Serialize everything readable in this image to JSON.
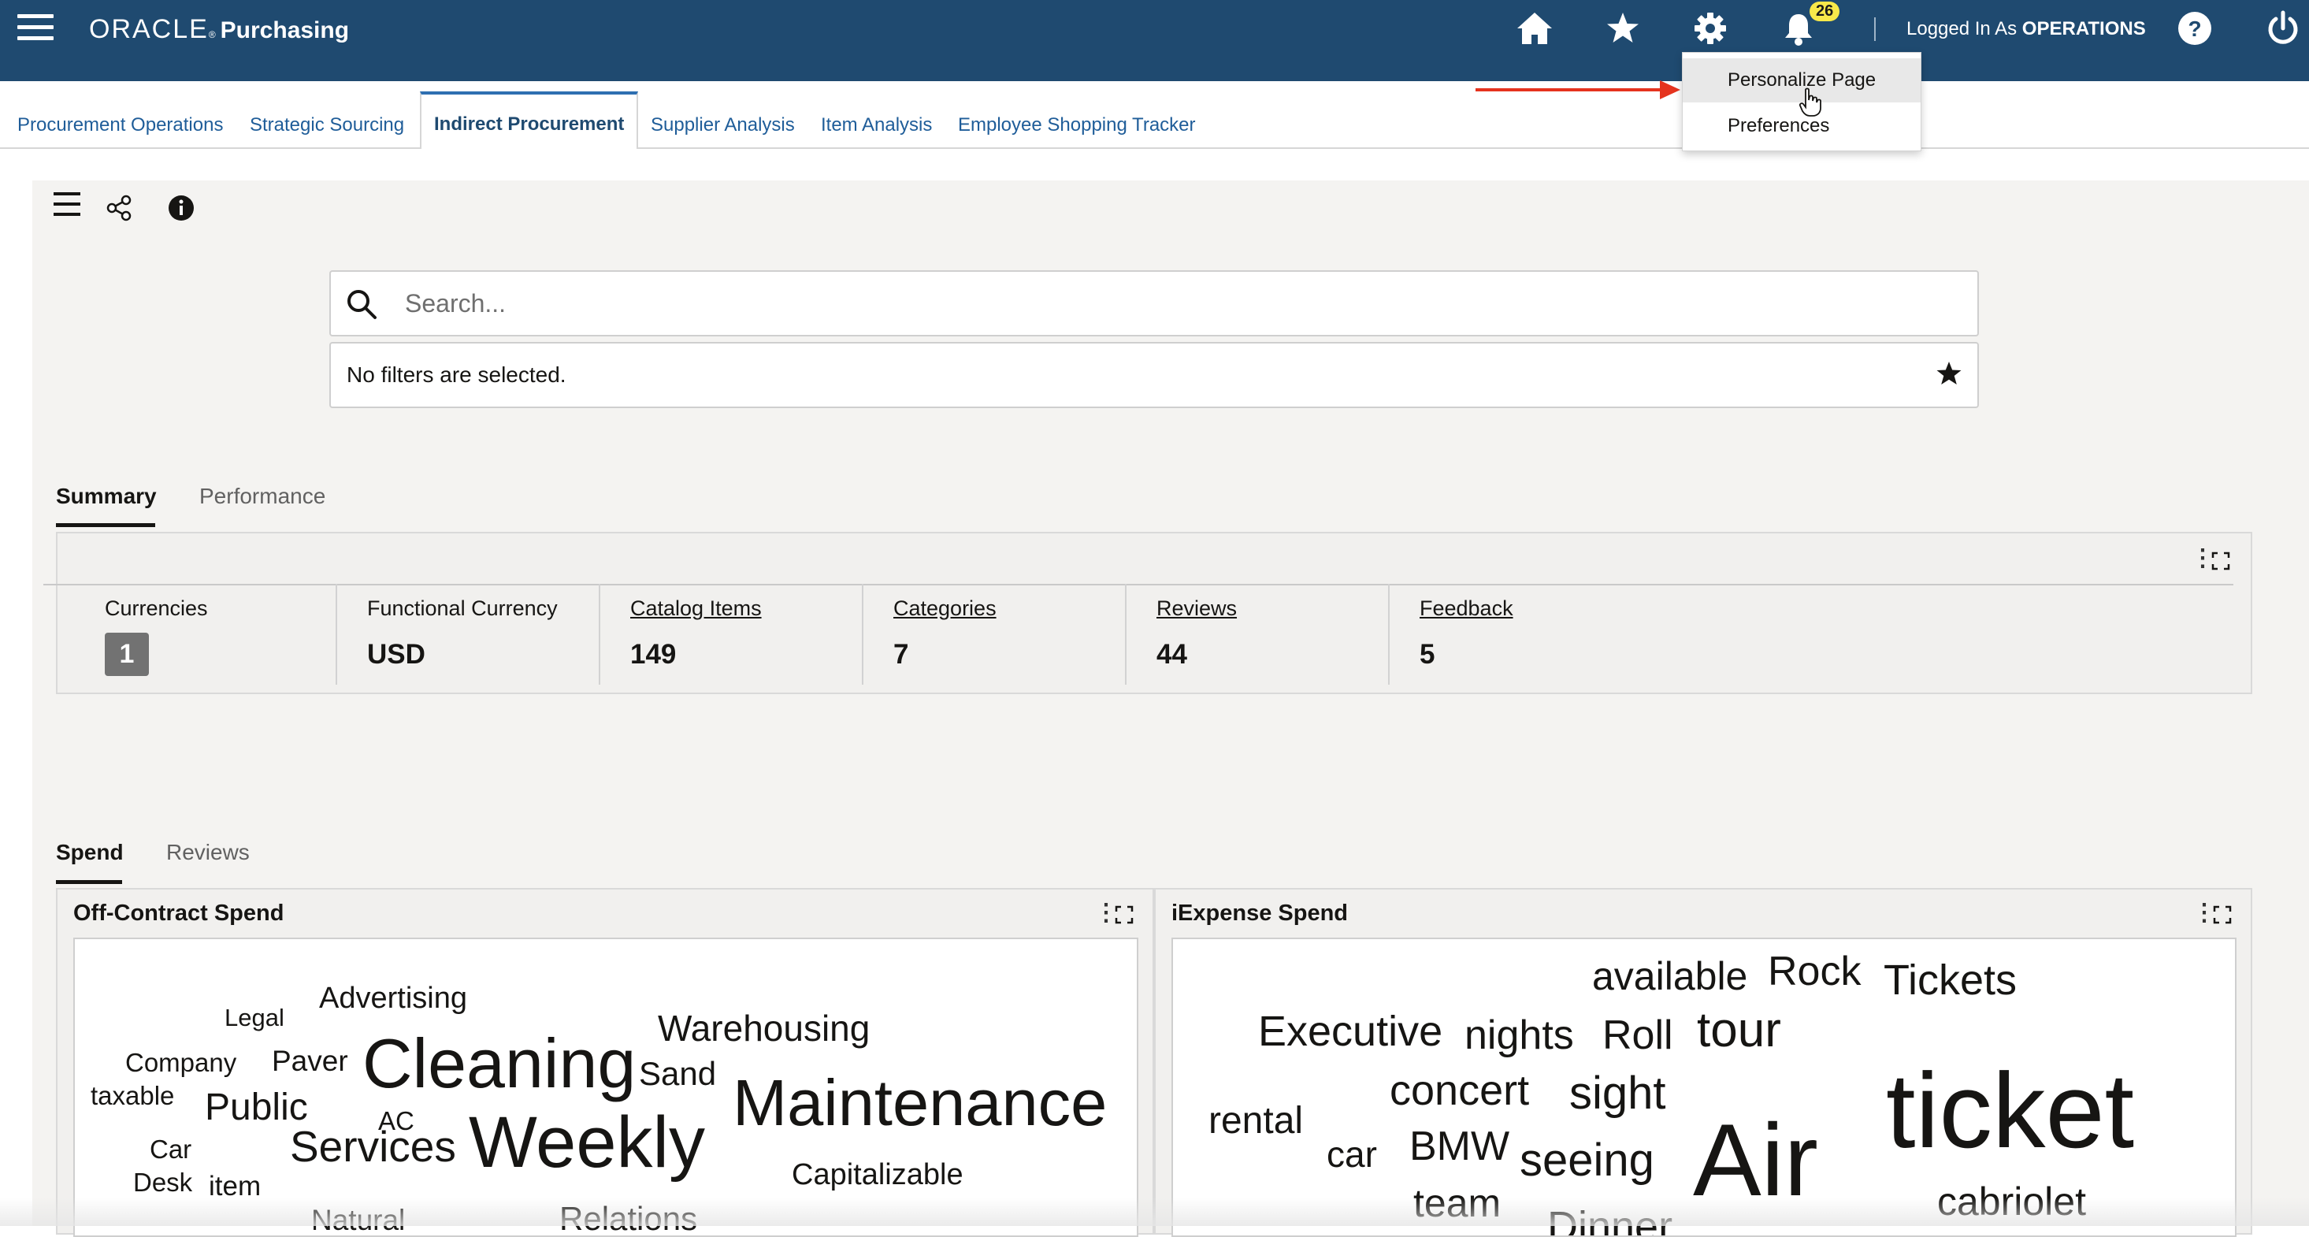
{
  "header": {
    "brand": "ORACLE",
    "brand_mark": "®",
    "product": "Purchasing",
    "notification_count": "26",
    "logged_in_prefix": "Logged In As",
    "logged_in_user": "OPERATIONS",
    "icons": [
      "hamburger-icon",
      "home-icon",
      "star-icon",
      "gear-icon",
      "bell-icon",
      "help-icon",
      "power-icon"
    ],
    "bar_color": "#1f4a70"
  },
  "settings_menu": {
    "items": [
      "Personalize Page",
      "Preferences"
    ],
    "highlighted": "Personalize Page"
  },
  "nav_tabs": [
    {
      "label": "Procurement Operations"
    },
    {
      "label": "Strategic Sourcing"
    },
    {
      "label": "Indirect Procurement",
      "active": true
    },
    {
      "label": "Supplier Analysis"
    },
    {
      "label": "Item Analysis"
    },
    {
      "label": "Employee Shopping Tracker"
    }
  ],
  "toolbar": {
    "icons": [
      "list-menu-icon",
      "share-icon",
      "info-icon"
    ]
  },
  "search": {
    "placeholder": "Search...",
    "value": ""
  },
  "filters": {
    "text": "No filters are selected."
  },
  "summary_tabs": [
    "Summary",
    "Performance"
  ],
  "metrics": [
    {
      "label": "Currencies",
      "value": "1"
    },
    {
      "label": "Functional Currency",
      "value": "USD"
    },
    {
      "label": "Catalog Items",
      "value": "149"
    },
    {
      "label": "Categories",
      "value": "7"
    },
    {
      "label": "Reviews",
      "value": "44"
    },
    {
      "label": "Feedback",
      "value": "5"
    }
  ],
  "spend_tabs": [
    "Spend",
    "Reviews"
  ],
  "off_contract": {
    "title": "Off-Contract Spend",
    "words": [
      "Legal",
      "Advertising",
      "Company",
      "Paver",
      "Cleaning",
      "Warehousing",
      "taxable",
      "Sand",
      "Public",
      "AC",
      "Maintenance",
      "Car",
      "Services",
      "Weekly",
      "Desk",
      "item",
      "Capitalizable",
      "Natural",
      "Relations"
    ]
  },
  "iexpense": {
    "title": "iExpense Spend",
    "words": [
      "available",
      "Rock",
      "Tickets",
      "Executive",
      "nights",
      "Roll",
      "tour",
      "concert",
      "sight",
      "rental",
      "ticket",
      "car",
      "BMW",
      "seeing",
      "Air",
      "team",
      "cabriolet",
      "Dinner"
    ]
  }
}
